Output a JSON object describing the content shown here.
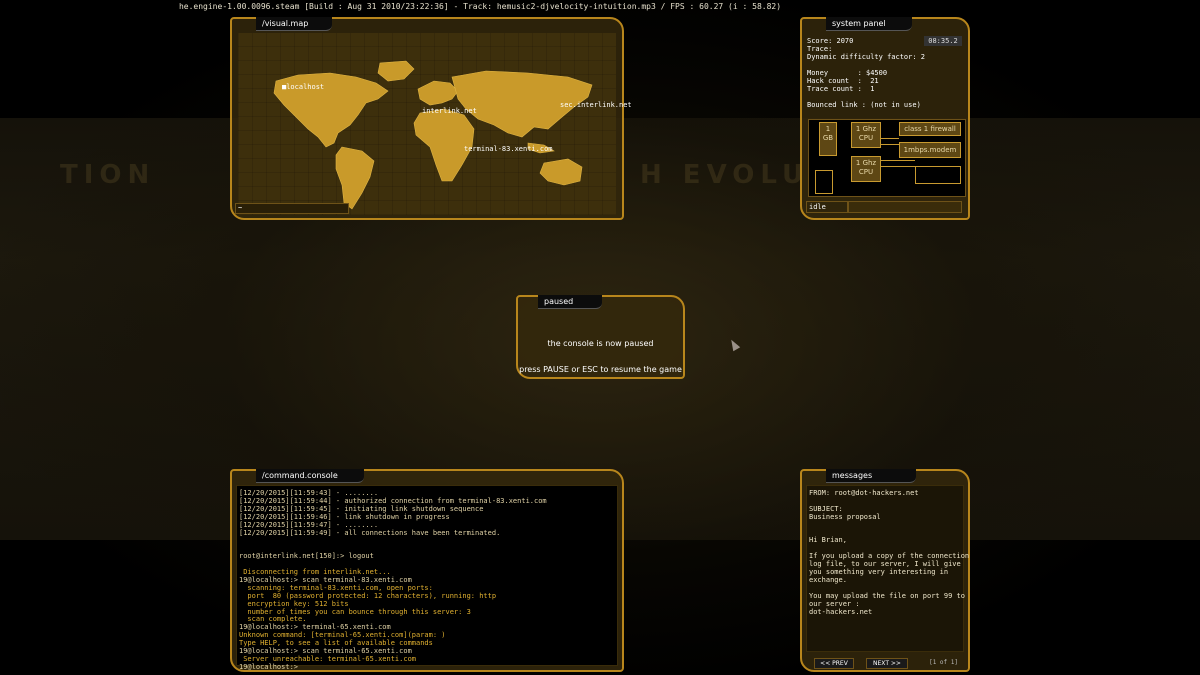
{
  "topbar": {
    "text": "he.engine-1.00.0096.steam [Build : Aug 31 2010/23:22:36] - Track: hemusic2-djvelocity-intuition.mp3 / FPS : 60.27 (i : 58.82)"
  },
  "background": {
    "left_text": "TION",
    "right_text": "H EVOLUTIO"
  },
  "visual_map": {
    "title": "/visual.map",
    "labels": {
      "localhost": "localhost",
      "interlink": "interlink.net",
      "sec_interlink": "sec.interlink.net",
      "terminal": "terminal-83.xenti.com"
    },
    "input_value": "~"
  },
  "system_panel": {
    "title": "system panel",
    "clock": "08:35.2",
    "stats_text": "Score: 2070\nTrace:\nDynamic difficulty factor: 2\n\nMoney       : $4500\nHack count  :  21\nTrace count :  1\n\nBounced link : (not in use)",
    "hardware": {
      "ram": "1\nGB",
      "cpu1": "1 Ghz\nCPU",
      "cpu2": "1 Ghz\nCPU",
      "firewall": "class 1 firewall",
      "modem": "1mbps.modem"
    },
    "status": "idle"
  },
  "paused": {
    "title": "paused",
    "line1": "the console is now paused",
    "line2": "press PAUSE or ESC to resume the game"
  },
  "command_console": {
    "title": "/command.console",
    "lines": [
      {
        "text": "[12/20/2015][11:59:43] - ........",
        "color": "#e0d2a6"
      },
      {
        "text": "[12/20/2015][11:59:44] - authorized connection from terminal-83.xenti.com",
        "color": "#e0d2a6"
      },
      {
        "text": "[12/20/2015][11:59:45] - initiating link shutdown sequence",
        "color": "#e0d2a6"
      },
      {
        "text": "[12/20/2015][11:59:46] - link shutdown in progress",
        "color": "#e0d2a6"
      },
      {
        "text": "[12/20/2015][11:59:47] - ........",
        "color": "#e0d2a6"
      },
      {
        "text": "[12/20/2015][11:59:49] - all connections have been terminated.",
        "color": "#e0d2a6"
      },
      {
        "text": "",
        "color": "#e0d2a6"
      },
      {
        "text": "",
        "color": "#e0d2a6"
      },
      {
        "text": "root@interlink.net[150]:> logout",
        "color": "#e0d2a6"
      },
      {
        "text": "",
        "color": "#e0d2a6"
      },
      {
        "text": " Disconnecting from interlink.net...",
        "color": "#e0b030"
      },
      {
        "text": "19@localhost:> scan terminal-83.xenti.com",
        "color": "#e0d2a6"
      },
      {
        "text": "  scanning: terminal-83.xenti.com, open ports:",
        "color": "#e0b030"
      },
      {
        "text": "  port  80 (password protected: 12 characters), running: http",
        "color": "#e0b030"
      },
      {
        "text": "  encryption key: 512 bits",
        "color": "#e0b030"
      },
      {
        "text": "  number of times you can bounce through this server: 3",
        "color": "#e0b030"
      },
      {
        "text": "  scan complete.",
        "color": "#e0b030"
      },
      {
        "text": "19@localhost:> terminal-65.xenti.com",
        "color": "#e0d2a6"
      },
      {
        "text": "Unknown command: [terminal-65.xenti.com](param: )",
        "color": "#e0b030"
      },
      {
        "text": "Type HELP, to see a list of available commands",
        "color": "#e0b030"
      },
      {
        "text": "19@localhost:> scan terminal-65.xenti.com",
        "color": "#e0d2a6"
      },
      {
        "text": " Server unreachable: terminal-65.xenti.com",
        "color": "#e0b030"
      },
      {
        "text": "19@localhost:>",
        "color": "#e0d2a6"
      }
    ]
  },
  "messages": {
    "title": "messages",
    "lines": [
      "FROM: root@dot-hackers.net",
      "",
      "SUBJECT:",
      "Business proposal",
      "",
      "",
      "Hi Brian,",
      "",
      "If you upload a copy of the connection",
      "log file, to our server, I will give",
      "you something very interesting in",
      "exchange.",
      "",
      "You may upload the file on port 99 to",
      "our server :",
      "dot-hackers.net"
    ],
    "prev_label": "<< PREV",
    "next_label": "NEXT >>",
    "page_indicator": "[1 of 1]"
  }
}
